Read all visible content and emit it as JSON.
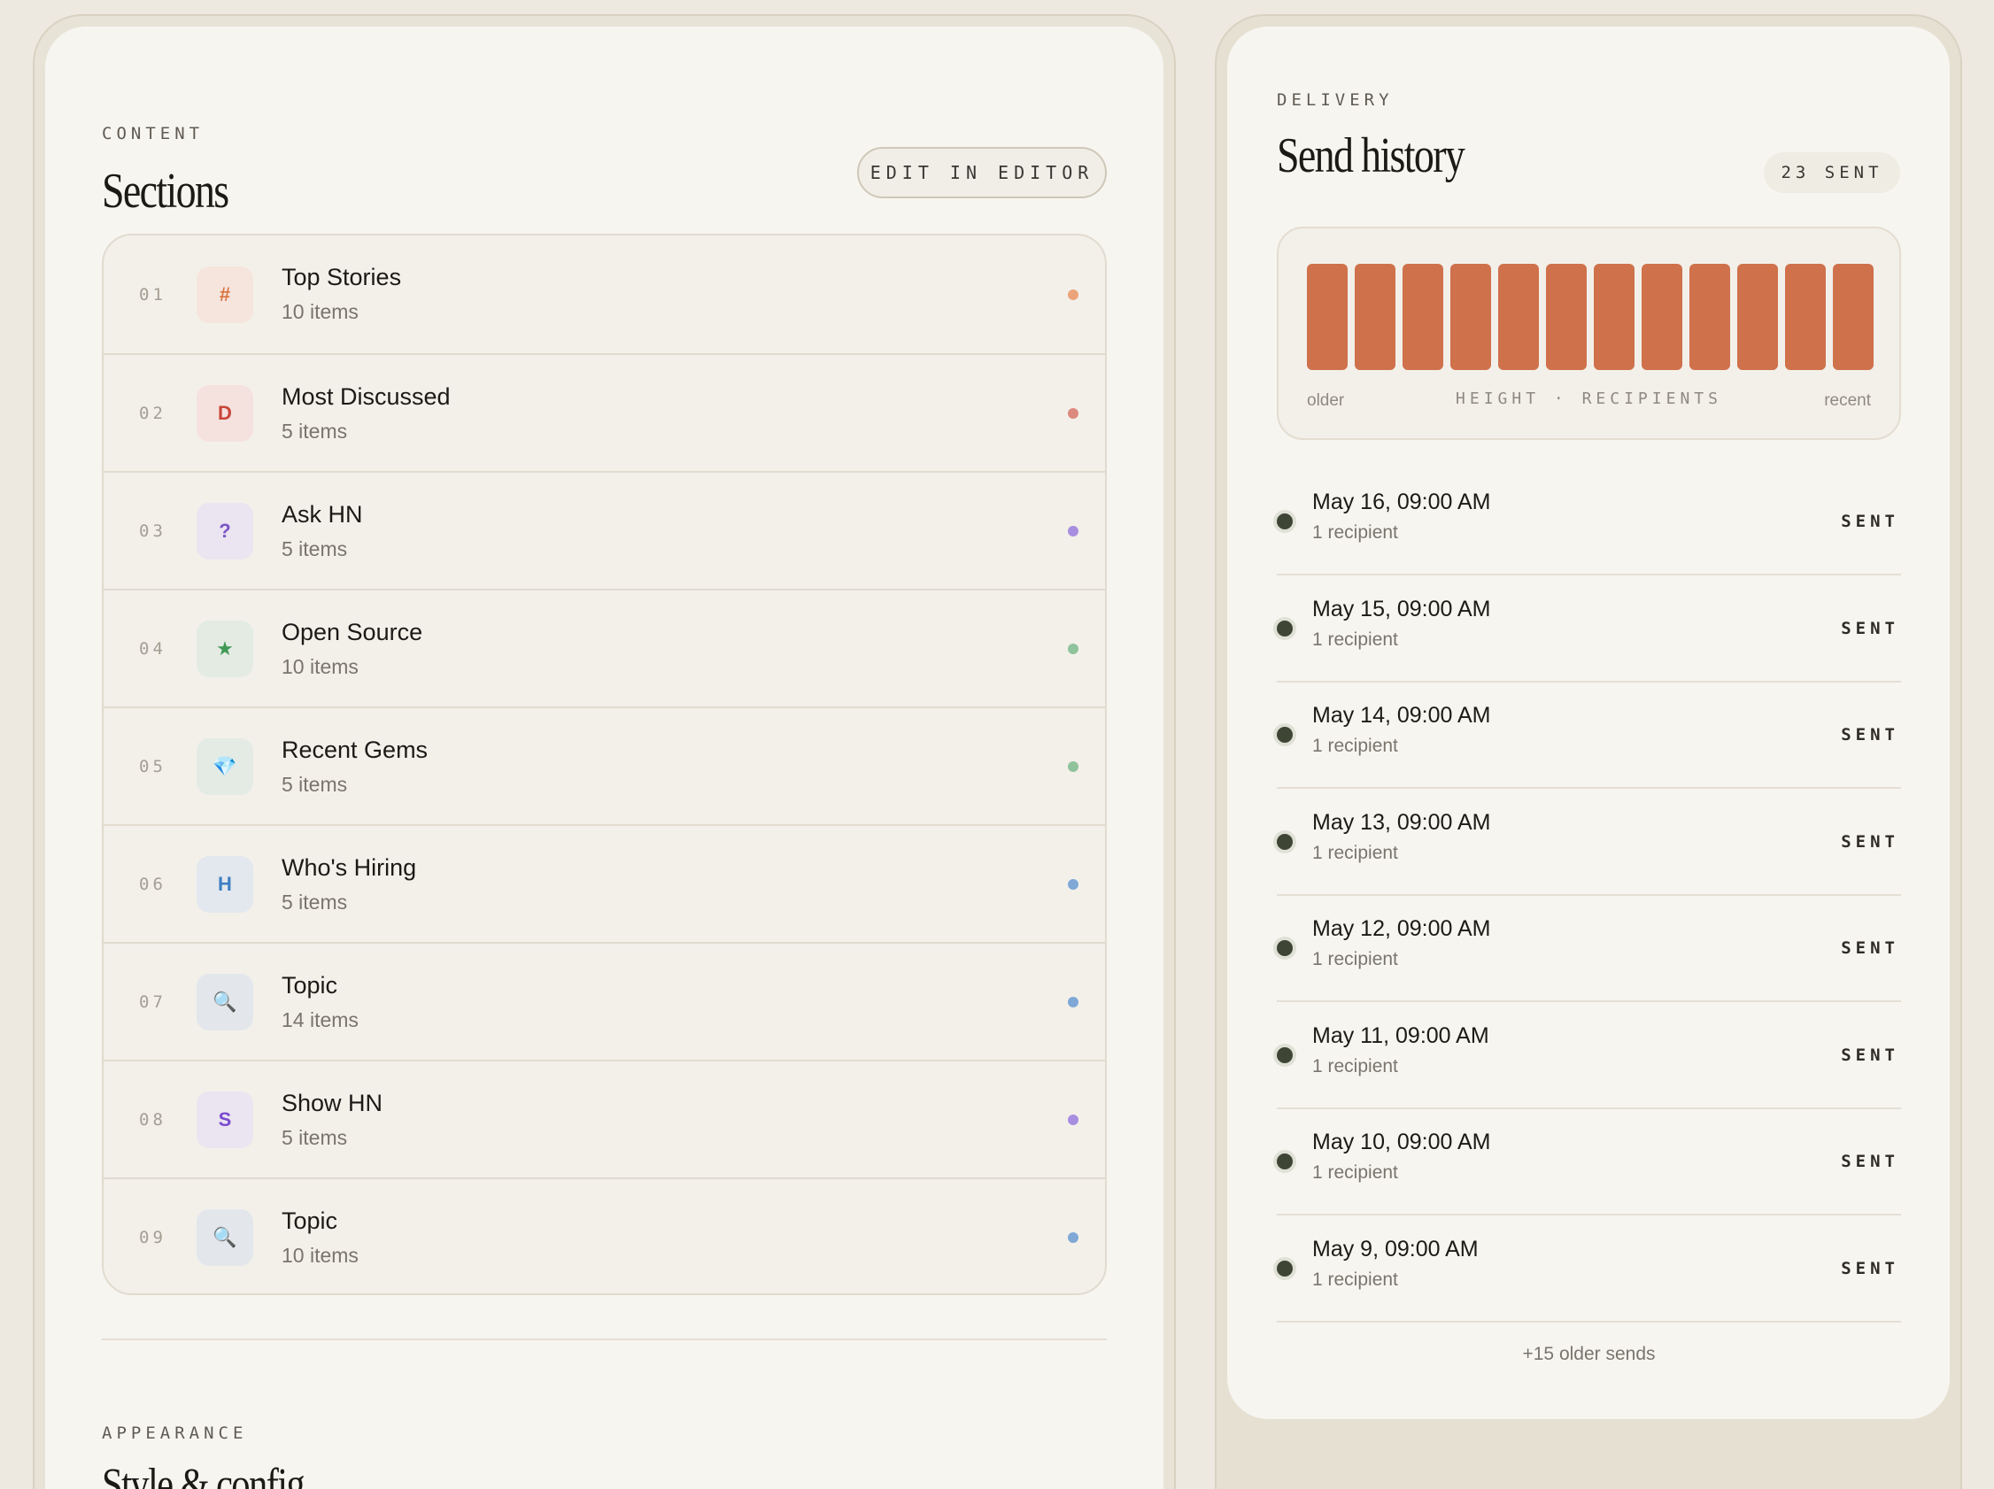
{
  "content": {
    "eyebrow": "CONTENT",
    "title": "Sections",
    "edit_button": "EDIT IN EDITOR",
    "sections": [
      {
        "num": "01",
        "icon": "#",
        "icon_name": "hash-icon",
        "title": "Top Stories",
        "sub": "10 items",
        "icon_color": "#d9743f",
        "icon_bg": "#f5e5dc",
        "dot": "#eba47a"
      },
      {
        "num": "02",
        "icon": "D",
        "icon_name": "letter-d-icon",
        "title": "Most Discussed",
        "sub": "5 items",
        "icon_color": "#c8463b",
        "icon_bg": "#f5e1de",
        "dot": "#dd8a7e"
      },
      {
        "num": "03",
        "icon": "?",
        "icon_name": "question-icon",
        "title": "Ask HN",
        "sub": "5 items",
        "icon_color": "#7a55c6",
        "icon_bg": "#ebe4f1",
        "dot": "#a88ee0"
      },
      {
        "num": "04",
        "icon": "★",
        "icon_name": "star-icon",
        "title": "Open Source",
        "sub": "10 items",
        "icon_color": "#3f9a55",
        "icon_bg": "#e3ebe2",
        "dot": "#8fc39b"
      },
      {
        "num": "05",
        "icon": "💎",
        "icon_name": "gem-icon",
        "title": "Recent Gems",
        "sub": "5 items",
        "icon_color": "#4f95d6",
        "icon_bg": "#e4ebe4",
        "dot": "#8fc39b"
      },
      {
        "num": "06",
        "icon": "H",
        "icon_name": "letter-h-icon",
        "title": "Who's Hiring",
        "sub": "5 items",
        "icon_color": "#3e7fc2",
        "icon_bg": "#e2e8ee",
        "dot": "#7fa8d6"
      },
      {
        "num": "07",
        "icon": "🔍",
        "icon_name": "magnifier-icon",
        "title": "Topic",
        "sub": "14 items",
        "icon_color": "#4a4a4a",
        "icon_bg": "#e3e7ec",
        "dot": "#7fa8d6"
      },
      {
        "num": "08",
        "icon": "S",
        "icon_name": "letter-s-icon",
        "title": "Show HN",
        "sub": "5 items",
        "icon_color": "#7a4ad0",
        "icon_bg": "#ebe4f1",
        "dot": "#a88ee0"
      },
      {
        "num": "09",
        "icon": "🔍",
        "icon_name": "magnifier-icon",
        "title": "Topic",
        "sub": "10 items",
        "icon_color": "#4a4a4a",
        "icon_bg": "#e3e7ec",
        "dot": "#7fa8d6"
      }
    ]
  },
  "appearance": {
    "eyebrow": "APPEARANCE",
    "title": "Style & config"
  },
  "delivery": {
    "eyebrow": "DELIVERY",
    "title": "Send history",
    "sent_count": "23 SENT",
    "chart": {
      "bar_color": "#cf714b",
      "recipients": [
        1,
        1,
        1,
        1,
        1,
        1,
        1,
        1,
        1,
        1,
        1,
        1
      ],
      "label_left": "older",
      "label_mid": "HEIGHT · RECIPIENTS",
      "label_right": "recent"
    },
    "sends": [
      {
        "date": "May 16, 09:00 AM",
        "sub": "1 recipient",
        "status": "SENT"
      },
      {
        "date": "May 15, 09:00 AM",
        "sub": "1 recipient",
        "status": "SENT"
      },
      {
        "date": "May 14, 09:00 AM",
        "sub": "1 recipient",
        "status": "SENT"
      },
      {
        "date": "May 13, 09:00 AM",
        "sub": "1 recipient",
        "status": "SENT"
      },
      {
        "date": "May 12, 09:00 AM",
        "sub": "1 recipient",
        "status": "SENT"
      },
      {
        "date": "May 11, 09:00 AM",
        "sub": "1 recipient",
        "status": "SENT"
      },
      {
        "date": "May 10, 09:00 AM",
        "sub": "1 recipient",
        "status": "SENT"
      },
      {
        "date": "May 9, 09:00 AM",
        "sub": "1 recipient",
        "status": "SENT"
      }
    ],
    "older_sends": "+15 older sends"
  }
}
